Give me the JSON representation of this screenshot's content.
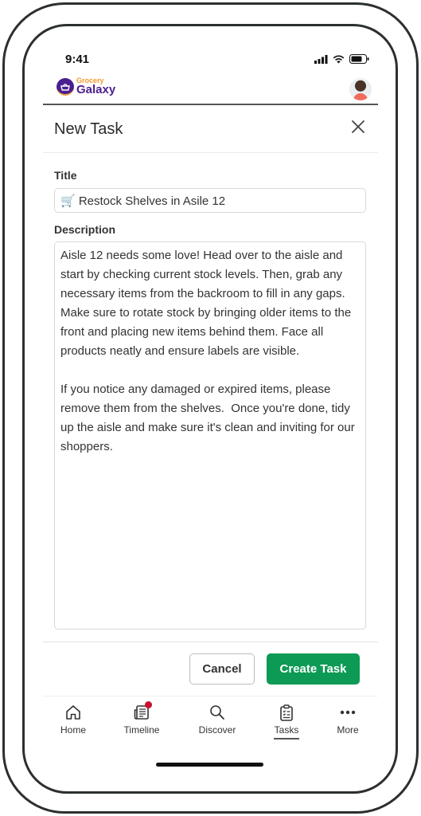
{
  "status_bar": {
    "time": "9:41",
    "icons": [
      "signal-icon",
      "wifi-icon",
      "battery-icon"
    ]
  },
  "app_header": {
    "logo_top": "Grocery",
    "logo_bottom": "Galaxy",
    "avatar_icon": "user-avatar"
  },
  "modal": {
    "title": "New Task",
    "close_icon": "close-icon",
    "title_label": "Title",
    "title_value": "🛒 Restock Shelves in Asile 12",
    "description_label": "Description",
    "description_value": "Aisle 12 needs some love! Head over to the aisle and start by checking current stock levels. Then, grab any necessary items from the backroom to fill in any gaps. Make sure to rotate stock by bringing older items to the front and placing new items behind them. Face all products neatly and ensure labels are visible.\n\nIf you notice any damaged or expired items, please remove them from the shelves.  Once you're done, tidy up the aisle and make sure it's clean and inviting for our shoppers.",
    "cancel_label": "Cancel",
    "create_label": "Create Task"
  },
  "colors": {
    "primary_green": "#0d9a55",
    "brand_purple": "#4b1f8f",
    "brand_orange": "#f29b2f",
    "badge_red": "#c8102e"
  },
  "bottom_nav": {
    "items": [
      {
        "label": "Home",
        "icon": "home-icon",
        "active": false
      },
      {
        "label": "Timeline",
        "icon": "timeline-icon",
        "active": false,
        "badge": true
      },
      {
        "label": "Discover",
        "icon": "search-icon",
        "active": false
      },
      {
        "label": "Tasks",
        "icon": "clipboard-icon",
        "active": true
      },
      {
        "label": "More",
        "icon": "more-icon",
        "active": false
      }
    ]
  }
}
